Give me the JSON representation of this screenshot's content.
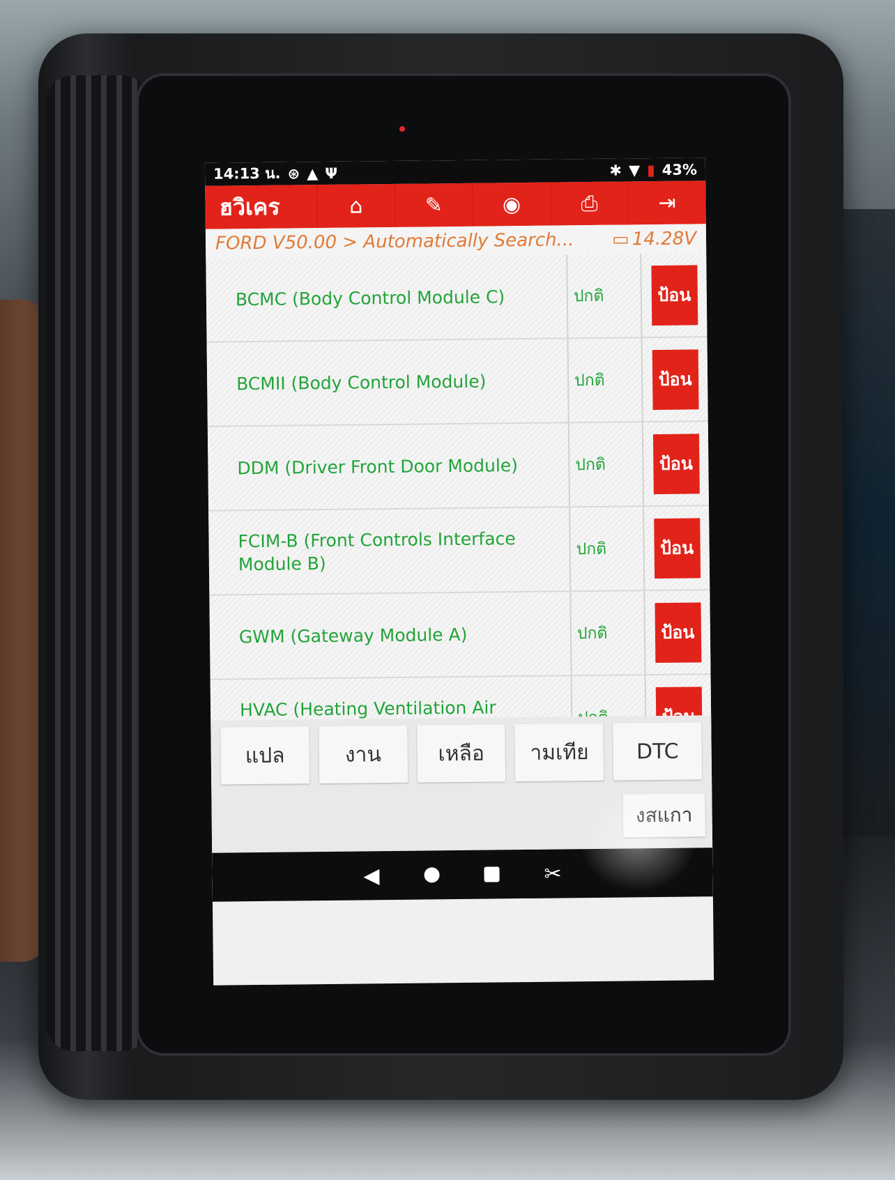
{
  "statusbar": {
    "time": "14:13 น.",
    "icons": [
      "accessibility-icon",
      "warning-icon",
      "usb-icon"
    ],
    "right_icons": [
      "bluetooth-icon",
      "wifi-icon",
      "battery-icon"
    ],
    "battery": "43%"
  },
  "toolbar": {
    "brand": "ฮวิเคร",
    "buttons": [
      {
        "icon": "home-icon",
        "glyph": "⌂"
      },
      {
        "icon": "edit-icon",
        "glyph": "✎"
      },
      {
        "icon": "support-icon",
        "glyph": "◉"
      },
      {
        "icon": "print-icon",
        "glyph": "⎙"
      },
      {
        "icon": "exit-icon",
        "glyph": "⇥"
      }
    ]
  },
  "breadcrumb": {
    "path": "FORD V50.00 > Automatically Search...",
    "voltage": "14.28V"
  },
  "modules": [
    {
      "name": "BCMC (Body Control Module C)",
      "status": "ปกติ",
      "action": "ป้อน"
    },
    {
      "name": "BCMII (Body Control Module)",
      "status": "ปกติ",
      "action": "ป้อน"
    },
    {
      "name": "DDM (Driver Front Door Module)",
      "status": "ปกติ",
      "action": "ป้อน"
    },
    {
      "name": "FCIM-B (Front Controls Interface Module B)",
      "status": "ปกติ",
      "action": "ป้อน"
    },
    {
      "name": "GWM (Gateway Module A)",
      "status": "ปกติ",
      "action": "ป้อน"
    },
    {
      "name": "HVAC (Heating Ventilation Air Conditioning)",
      "status": "ปกติ",
      "action": "ป้อน"
    }
  ],
  "function_buttons": [
    "แปล",
    "งาน",
    "เหลือ",
    "ามเทีย",
    "DTC"
  ],
  "extra_button": "งสแกา",
  "navbar": {
    "back": "◀",
    "recent_icon": "screenshot-icon",
    "recent_glyph": "✂"
  },
  "colors": {
    "accent": "#e2231a",
    "module_text": "#22a43a",
    "breadcrumb_text": "#e07a36"
  }
}
